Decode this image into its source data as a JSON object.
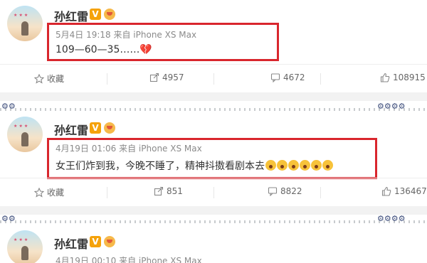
{
  "posts": [
    {
      "author": "孙红雷",
      "verified_mark": "V",
      "meta": "5月4日 19:18 来自 iPhone XS Max",
      "content": "109—60—35……",
      "content_emoji": "💔",
      "actions": {
        "favorite": "收藏",
        "repost": "4957",
        "comment": "4672",
        "like": "108915"
      }
    },
    {
      "author": "孙红雷",
      "verified_mark": "V",
      "meta": "4月19日 01:06 来自 iPhone XS Max",
      "content": "女王们炸到我，今晚不睡了，精神抖擞看剧本去",
      "content_emoji_count": 6,
      "actions": {
        "favorite": "收藏",
        "repost": "851",
        "comment": "8822",
        "like": "136467"
      }
    },
    {
      "author": "孙红雷",
      "verified_mark": "V",
      "meta": "4月19日 00:10 来自 iPhone XS Max"
    }
  ],
  "colors": {
    "highlight_box": "#d9262d",
    "verified": "#f5a20a",
    "text": "#333333",
    "meta": "#8a8a8a"
  },
  "icons": [
    "star-icon",
    "repost-icon",
    "comment-icon",
    "like-icon",
    "verified-icon",
    "badge-icon"
  ]
}
